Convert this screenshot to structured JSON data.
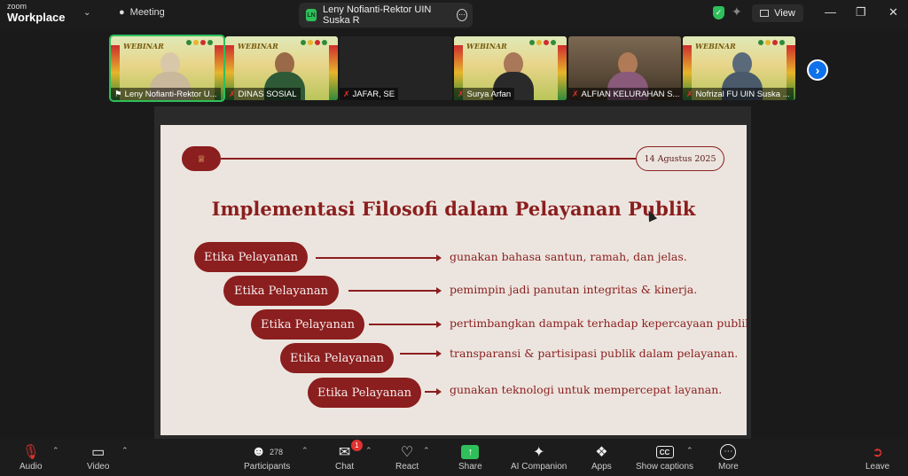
{
  "app": {
    "brand_small": "zoom",
    "brand_name": "Workplace"
  },
  "tabs": {
    "meeting_label": "Meeting",
    "active_initials": "LN",
    "active_title": "Leny Nofianti-Rektor UIN Suska R",
    "view_label": "View"
  },
  "gallery": {
    "participants": [
      {
        "name": "Leny Nofianti-Rektor U...",
        "pinned": true,
        "active": true
      },
      {
        "name": "DINAS SOSIAL"
      },
      {
        "name": "JAFAR, SE"
      },
      {
        "name": "Surya Arfan"
      },
      {
        "name": "ALFIAN KELURAHAN S..."
      },
      {
        "name": "Nofrizal FU UIN Suska ..."
      }
    ],
    "banner_text": "WEBINAR"
  },
  "slide": {
    "date": "14 Agustus 2025",
    "title": "Implementasi Filosofi dalam Pelayanan Publik",
    "rows": [
      {
        "label": "Etika Pelayanan",
        "text": "gunakan bahasa santun, ramah, dan jelas."
      },
      {
        "label": "Etika Pelayanan",
        "text": "pemimpin jadi panutan integritas & kinerja."
      },
      {
        "label": "Etika Pelayanan",
        "text": "pertimbangkan dampak terhadap kepercayaan publik."
      },
      {
        "label": "Etika Pelayanan",
        "text": "transparansi & partisipasi publik dalam pelayanan."
      },
      {
        "label": "Etika Pelayanan",
        "text": "gunakan teknologi untuk mempercepat layanan."
      }
    ],
    "accent": "#8b1e1e"
  },
  "toolbar": {
    "audio": "Audio",
    "video": "Video",
    "participants": "Participants",
    "participants_count": "278",
    "chat": "Chat",
    "chat_badge": "1",
    "react": "React",
    "share": "Share",
    "ai": "AI Companion",
    "apps": "Apps",
    "captions": "Show captions",
    "more": "More",
    "leave": "Leave"
  }
}
